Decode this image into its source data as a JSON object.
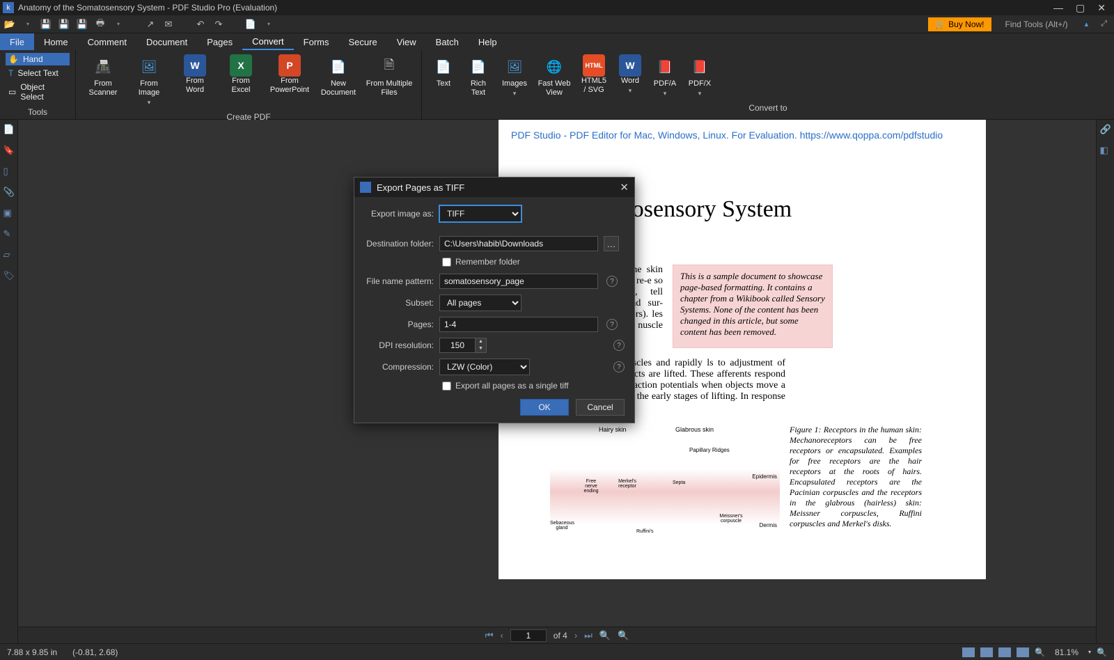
{
  "window": {
    "title": "Anatomy of the Somatosensory System - PDF Studio Pro (Evaluation)"
  },
  "quickbar": {
    "buy_now": "Buy Now!",
    "find_tools": "Find Tools  (Alt+/)"
  },
  "menu": {
    "items": [
      "File",
      "Home",
      "Comment",
      "Document",
      "Pages",
      "Convert",
      "Forms",
      "Secure",
      "View",
      "Batch",
      "Help"
    ],
    "active_index": 5
  },
  "tools_group": {
    "label": "Tools",
    "items": [
      "Hand",
      "Select Text",
      "Object Select"
    ]
  },
  "create_pdf": {
    "label": "Create PDF",
    "items": [
      {
        "label": "From\nScanner"
      },
      {
        "label": "From\nImage"
      },
      {
        "label": "From\nWord"
      },
      {
        "label": "From\nExcel"
      },
      {
        "label": "From\nPowerPoint"
      },
      {
        "label": "New\nDocument"
      },
      {
        "label": "From Multiple\nFiles"
      }
    ]
  },
  "convert_to": {
    "label": "Convert to",
    "items": [
      {
        "label": "Text"
      },
      {
        "label": "Rich\nText"
      },
      {
        "label": "Images"
      },
      {
        "label": "Fast Web\nView"
      },
      {
        "label": "HTML5\n/ SVG"
      },
      {
        "label": "Word"
      },
      {
        "label": "PDF/A"
      },
      {
        "label": "PDF/X"
      }
    ]
  },
  "dialog": {
    "title": "Export Pages as TIFF",
    "labels": {
      "export_image_as": "Export image as:",
      "destination_folder": "Destination folder:",
      "remember_folder": "Remember folder",
      "file_name_pattern": "File name pattern:",
      "subset": "Subset:",
      "pages": "Pages:",
      "dpi_resolution": "DPI resolution:",
      "compression": "Compression:",
      "export_all_single": "Export all pages as a single tiff"
    },
    "values": {
      "format": "TIFF",
      "folder": "C:\\Users\\habib\\Downloads",
      "pattern": "somatosensory_page",
      "subset": "All pages",
      "pages": "1-4",
      "dpi": "150",
      "compression": "LZW (Color)"
    },
    "buttons": {
      "ok": "OK",
      "cancel": "Cancel"
    }
  },
  "document": {
    "eval_text": "PDF Studio - PDF Editor for Mac, Windows, Linux. For Evaluation.  https://www.qoppa.com/pdfstudio",
    "heading": "of the Somatosensory System",
    "para1": "stem consists of sensors in the skin uscles, tendons, and joints. The re-e so called cutaneous receptors, tell thermoreceptors), pressure and sur- receptors), and pain (nociceptors). les and joints provide information nuscle tension, and joint angles.",
    "sidebox": "This is a sample document to showcase page-based formatting. It contains a chapter from a Wikibook called Sensory Systems. None of the content has been changed in this article, but some content has been removed.",
    "para2": "rom Meissner corpuscles and rapidly ls to adjustment of grip force when objects are lifted. These afferents respond with a brief burst of action potentials when objects move a small distance during the early stages of lifting. In response to",
    "fig_caption": "Figure 1:  Receptors in the human skin: Mechanoreceptors can be free receptors or encapsulated. Examples for free receptors are the hair receptors at the roots of hairs. Encapsulated receptors are the Pacinian corpuscles and the receptors in the glabrous (hairless) skin: Meissner corpuscles, Ruffini corpuscles and Merkel's disks.",
    "fig_labels": {
      "hairy": "Hairy skin",
      "glabrous": "Glabrous skin",
      "papillary": "Papillary Ridges",
      "epidermis": "Epidermis",
      "dermis": "Dermis",
      "fne": "Free nerve ending",
      "merkel": "Merkel's receptor",
      "septa": "Septa",
      "meissner": "Meissner's corpuscle",
      "ruffini": "Ruffini's",
      "sebaceous": "Sebaceous gland"
    }
  },
  "pagenav": {
    "current": "1",
    "of": "of 4"
  },
  "status": {
    "dims": "7.88 x 9.85 in",
    "coords": "(-0.81, 2.68)",
    "zoom": "81.1%"
  }
}
